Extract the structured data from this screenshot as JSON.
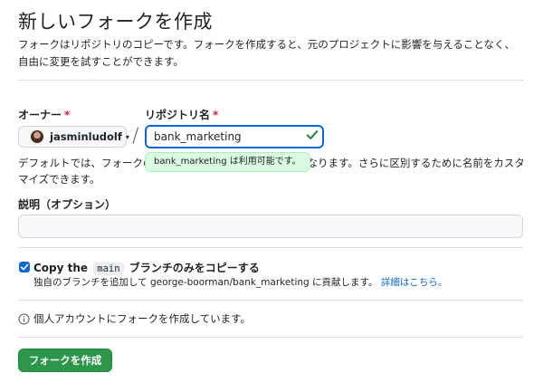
{
  "header": {
    "title": "新しいフォークを作成",
    "subtitle": "フォークはリポジトリのコピーです。フォークを作成すると、元のプロジェクトに影響を与えることなく、自由に変更を試すことができます。"
  },
  "owner": {
    "label": "オーナー",
    "required_mark": "*",
    "value": "jasminludolf",
    "caret": "▾"
  },
  "repo": {
    "label": "リポジトリ名",
    "required_mark": "*",
    "separator": "/",
    "value": "bank_marketing",
    "availability": "bank_marketing は利用可能です。",
    "default_note_before": "デフォルトでは、フォークの",
    "default_note_after": "なります。さらに区別するために名前をカスタマイズできます。"
  },
  "description": {
    "label": "説明（オプション）",
    "value": ""
  },
  "copy_branch": {
    "checked": true,
    "label_prefix": "Copy the",
    "branch": "main",
    "label_suffix": "ブランチのみをコピーする",
    "sub_text": "独自のブランチを追加して george-boorman/bank_marketing に貢献します。",
    "link": "詳細はこちら。"
  },
  "info": {
    "text": "個人アカウントにフォークを作成しています。"
  },
  "submit": {
    "label": "フォークを作成"
  },
  "colors": {
    "accent": "#0969da",
    "success": "#2c974b",
    "required": "#cf222e"
  }
}
